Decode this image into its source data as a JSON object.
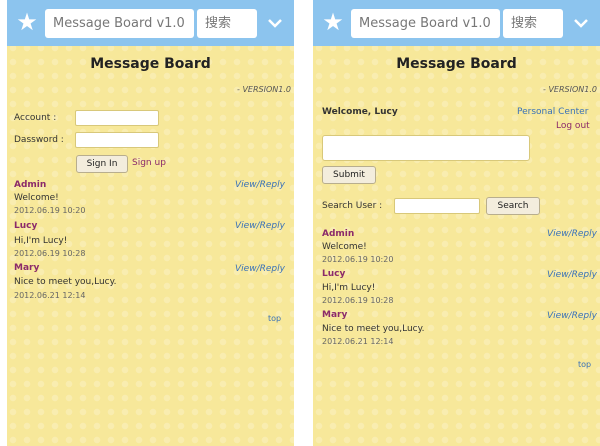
{
  "header": {
    "app_title": "Message Board v1.0",
    "search_label": "搜索"
  },
  "page": {
    "heading": "Message Board",
    "version": "- VERSION1.0",
    "top_link": "top"
  },
  "login": {
    "account_label": "Account :",
    "password_label": "Dassword :",
    "sign_in_label": "Sign In",
    "sign_up_label": "Sign up"
  },
  "user": {
    "welcome": "Welcome, Lucy",
    "personal_center": "Personal Center",
    "logout": "Log out",
    "submit_label": "Submit",
    "search_user_label": "Search User :",
    "search_button": "Search"
  },
  "posts": [
    {
      "author": "Admin",
      "text": "Welcome!",
      "date": "2012.06.19 10:20",
      "action": "View/Reply"
    },
    {
      "author": "Lucy",
      "text": "Hi,I'm Lucy!",
      "date": "2012.06.19 10:28",
      "action": "View/Reply"
    },
    {
      "author": "Mary",
      "text": "Nice to meet you,Lucy.",
      "date": "2012.06.21 12:14",
      "action": "View/Reply"
    }
  ],
  "colors": {
    "header_bg": "#8cc4ee",
    "page_bg": "#f7e89a",
    "author": "#8b2a6a",
    "link": "#3a72b8"
  }
}
